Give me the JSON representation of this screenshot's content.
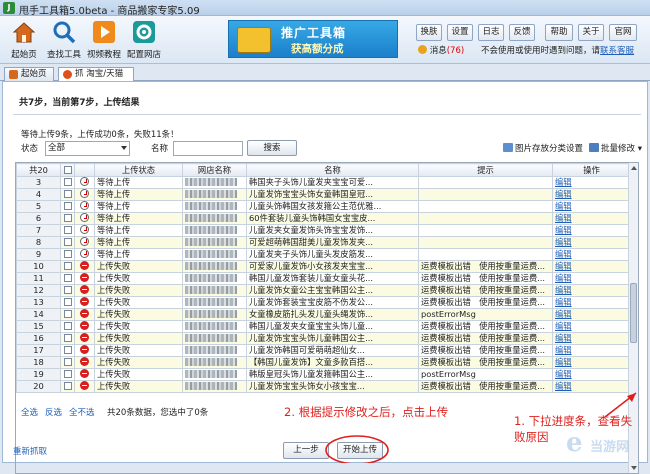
{
  "window": {
    "title": "甩手工具箱5.0beta - 商品搬家专家5.09"
  },
  "toolbar": {
    "buttons": [
      {
        "label": "起始页",
        "icon": "home-icon",
        "color": "#d2691e"
      },
      {
        "label": "查找工具",
        "icon": "search-icon",
        "color": "#2a7fc9"
      },
      {
        "label": "视频教程",
        "icon": "play-icon",
        "color": "#e8801a"
      },
      {
        "label": "配置网店",
        "icon": "gear-icon",
        "color": "#1a9a9a"
      }
    ],
    "banner": {
      "line1": "推广工具箱",
      "line2": "获高额分成"
    },
    "header_buttons": [
      "换肤",
      "设置",
      "日志",
      "反馈",
      "帮助",
      "关于",
      "官网"
    ],
    "messages_label": "消息",
    "messages_count": "(76)",
    "notice": "不会使用或使用时遇到问题，请",
    "notice_link": "联系客服"
  },
  "tabs": [
    {
      "label": "起始页",
      "active": false
    },
    {
      "label": "抓 淘宝/天猫",
      "active": true
    }
  ],
  "main": {
    "steps": "共7步，当前第7步，上传结果",
    "stats": "等待上传9条，上传成功0条，失败11条！",
    "filter_status_label": "状态",
    "filter_status_value": "全部",
    "filter_name_label": "名称",
    "search_button": "搜索",
    "image_category_setting": "图片存放分类设置",
    "bulk_edit": "批量修改"
  },
  "table": {
    "headers": [
      "共20",
      "",
      "",
      "上传状态",
      "网店名称",
      "名称",
      "提示",
      "操作"
    ],
    "rows": [
      {
        "no": "3",
        "status": "等待上传",
        "kind": "wait",
        "name": "韩国夹子头饰儿童发夹宝宝可爱...",
        "hint": "",
        "op": "编辑"
      },
      {
        "no": "4",
        "status": "等待上传",
        "kind": "wait",
        "name": "儿童发饰宝宝头饰女童韩国皇冠...",
        "hint": "",
        "op": "编辑"
      },
      {
        "no": "5",
        "status": "等待上传",
        "kind": "wait",
        "name": "儿童头饰韩国女孩发箍公主范优雅...",
        "hint": "",
        "op": "编辑"
      },
      {
        "no": "6",
        "status": "等待上传",
        "kind": "wait",
        "name": "60件套装儿童头饰韩国女宝宝皮...",
        "hint": "",
        "op": "编辑"
      },
      {
        "no": "7",
        "status": "等待上传",
        "kind": "wait",
        "name": "儿童发夹女童发饰头饰宝宝发饰...",
        "hint": "",
        "op": "编辑"
      },
      {
        "no": "8",
        "status": "等待上传",
        "kind": "wait",
        "name": "可爱超萌韩国甜美儿童发饰发夹...",
        "hint": "",
        "op": "编辑"
      },
      {
        "no": "9",
        "status": "等待上传",
        "kind": "wait",
        "name": "儿童发夹子头饰儿童头发皮筋发...",
        "hint": "",
        "op": "编辑"
      },
      {
        "no": "10",
        "status": "上传失败",
        "kind": "fail",
        "name": "可爱家儿童发饰小女孩发夹宝宝...",
        "hint": "运费模板出错　使用按重量运费...",
        "op": "编辑"
      },
      {
        "no": "11",
        "status": "上传失败",
        "kind": "fail",
        "name": "韩国儿童发饰套装儿童女童头花...",
        "hint": "运费模板出错　使用按重量运费...",
        "op": "编辑"
      },
      {
        "no": "12",
        "status": "上传失败",
        "kind": "fail",
        "name": "儿童发饰女童公主宝宝韩国公主...",
        "hint": "运费模板出错　使用按重量运费...",
        "op": "编辑"
      },
      {
        "no": "13",
        "status": "上传失败",
        "kind": "fail",
        "name": "儿童发饰套装宝宝皮筋不伤发公...",
        "hint": "运费模板出错　使用按重量运费...",
        "op": "编辑"
      },
      {
        "no": "14",
        "status": "上传失败",
        "kind": "fail",
        "name": "女童橡皮筋扎头发儿童头绳发饰...",
        "hint": "postErrorMsg",
        "op": "编辑"
      },
      {
        "no": "15",
        "status": "上传失败",
        "kind": "fail",
        "name": "韩国儿童发夹女童宝宝头饰儿童...",
        "hint": "运费模板出错　使用按重量运费...",
        "op": "编辑"
      },
      {
        "no": "16",
        "status": "上传失败",
        "kind": "fail",
        "name": "儿童发饰宝宝头饰儿童韩国公主...",
        "hint": "运费模板出错　使用按重量运费...",
        "op": "编辑"
      },
      {
        "no": "17",
        "status": "上传失败",
        "kind": "fail",
        "name": "儿童发饰韩国可爱萌萌超仙女...",
        "hint": "运费模板出错　使用按重量运费...",
        "op": "编辑"
      },
      {
        "no": "18",
        "status": "上传失败",
        "kind": "fail",
        "name": "【韩国儿童发饰】文童多款百搭...",
        "hint": "运费模板出错　使用按重量运费...",
        "op": "编辑"
      },
      {
        "no": "19",
        "status": "上传失败",
        "kind": "fail",
        "name": "韩版皇冠头饰儿童发箍韩国公主...",
        "hint": "postErrorMsg",
        "op": "编辑"
      },
      {
        "no": "20",
        "status": "上传失败",
        "kind": "fail",
        "name": "儿童发饰宝宝头饰女小孩宝宝...",
        "hint": "运费模板出错　使用按重量运费...",
        "op": "编辑"
      }
    ]
  },
  "footer": {
    "select_all": "全选",
    "invert": "反选",
    "select_none": "全不选",
    "summary": "共20条数据，您选中了0条",
    "recapture": "重新抓取",
    "prev_button": "上一步",
    "start_upload_button": "开始上传"
  },
  "annotations": {
    "note1_line1": "1. 下拉进度条，查看失",
    "note1_line2": "败原因",
    "note2": "2. 根据提示修改之后，点击上传"
  },
  "watermark": {
    "logo": "e",
    "text": "当游网"
  }
}
